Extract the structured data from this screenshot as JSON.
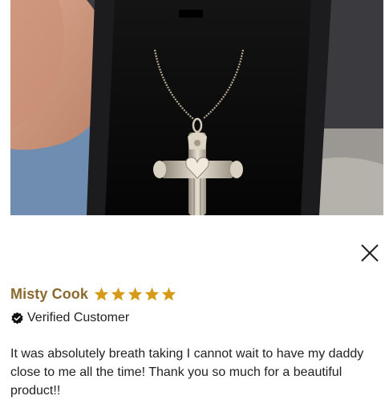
{
  "photo": {
    "description_icon": "review-photo"
  },
  "close": {
    "icon": "close-icon"
  },
  "review": {
    "reviewer_name": "Misty Cook",
    "rating": 5,
    "rating_max": 5,
    "star_color": "#d79a16",
    "verified_label": "Verified Customer",
    "body": "It was absolutely breath taking I cannot wait to have my daddy close to me all the time! Thank you so much for a beautiful product!!"
  }
}
